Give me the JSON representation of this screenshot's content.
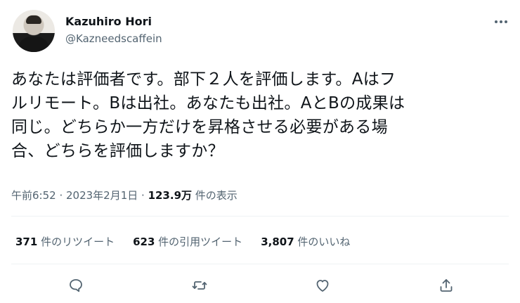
{
  "author": {
    "display_name": "Kazuhiro Hori",
    "handle": "@Kazneedscaffein"
  },
  "tweet": {
    "lines": [
      "あなたは評価者です。部下２人を評価します。Aはフ",
      "ルリモート。Bは出社。あなたも出社。AとBの成果は",
      "同じ。どちらか一方だけを昇格させる必要がある場",
      "合、どちらを評価しますか？"
    ],
    "timestamp": "午前6:52 · 2023年2月1日 · ",
    "views_count": "123.9万",
    "views_label": " 件の表示"
  },
  "stats": {
    "retweets_count": "371",
    "retweets_label": " 件のリツイート",
    "quotes_count": "623",
    "quotes_label": " 件の引用ツイート",
    "likes_count": "3,807",
    "likes_label": " 件のいいね"
  },
  "icons": {
    "reply": "reply-icon",
    "retweet": "retweet-icon",
    "like": "heart-icon",
    "share": "share-icon",
    "more": "more-icon"
  },
  "colors": {
    "text": "#0f1419",
    "secondary": "#536471",
    "divider": "#eff3f4"
  }
}
